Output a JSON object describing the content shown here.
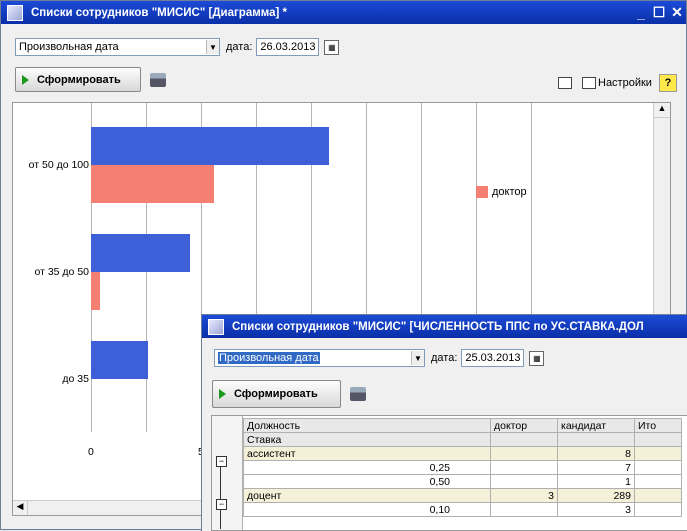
{
  "window1": {
    "title": "Списки сотрудников \"МИСИС\" [Диаграмма] *",
    "controls": {
      "minimize": "_",
      "maximize": "☐",
      "close": "✕"
    },
    "period_select": "Произвольная дата",
    "date_label": "дата:",
    "date_value": "26.03.2013",
    "form_button": "Сформировать",
    "settings_label": "Настройки",
    "help_label": "?",
    "chart_data": {
      "type": "bar",
      "orientation": "horizontal",
      "categories": [
        "от 50 до 100",
        "от 35 до 50",
        "до 35"
      ],
      "series": [
        {
          "values": [
            108,
            45,
            26
          ],
          "color": "#3d5fd8"
        },
        {
          "name": "доктор",
          "values": [
            56,
            4,
            0
          ],
          "color": "#f47f72"
        }
      ],
      "xticks": [
        "0",
        "50"
      ],
      "xlim": [
        0,
        200
      ],
      "legend_position": "right"
    }
  },
  "window2": {
    "title": "Списки сотрудников \"МИСИС\" [ЧИСЛЕННОСТЬ ППС по УС.СТАВКА.ДОЛ",
    "period_select": "Произвольная дата",
    "date_label": "дата:",
    "date_value": "25.03.2013",
    "form_button": "Сформировать",
    "table": {
      "header": [
        "Должность",
        "доктор",
        "кандидат",
        "Ито"
      ],
      "subheader": "Ставка",
      "rows": [
        {
          "label": "ассистент",
          "group": true,
          "doctor": "",
          "cand": "8"
        },
        {
          "label": "0,25",
          "group": false,
          "doctor": "",
          "cand": "7"
        },
        {
          "label": "0,50",
          "group": false,
          "doctor": "",
          "cand": "1"
        },
        {
          "label": "доцент",
          "group": true,
          "doctor": "3",
          "cand": "289"
        },
        {
          "label": "0,10",
          "group": false,
          "doctor": "",
          "cand": "3"
        }
      ]
    }
  }
}
